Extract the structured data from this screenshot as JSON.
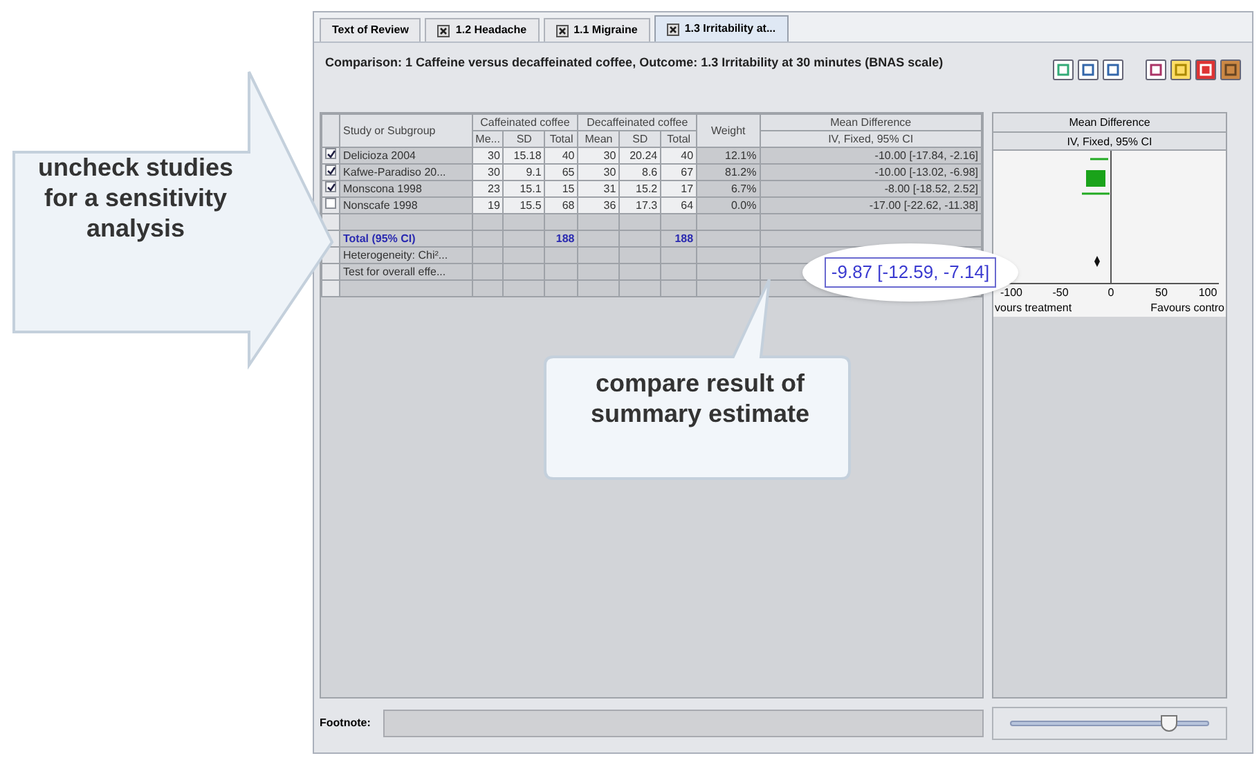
{
  "tabs": [
    {
      "label": "Text of Review",
      "kind": "plain",
      "selected": false
    },
    {
      "label": "1.2 Headache",
      "kind": "closable",
      "selected": false
    },
    {
      "label": "1.1 Migraine",
      "kind": "closable",
      "selected": false
    },
    {
      "label": "1.3 Irritability at...",
      "kind": "closable",
      "selected": true
    }
  ],
  "comparison_title": "Comparison: 1 Caffeine versus decaffeinated coffee, Outcome: 1.3 Irritability at 30 minutes (BNAS scale)",
  "table": {
    "study_header": "Study or Subgroup",
    "group_headers": [
      "Caffeinated coffee",
      "Decaffeinated coffee"
    ],
    "sub_headers": [
      "Me...",
      "SD",
      "Total",
      "Mean",
      "SD",
      "Total"
    ],
    "weight_header": "Weight",
    "effect_header": "Mean Difference",
    "effect_subheader": "IV, Fixed, 95% CI",
    "studies": [
      {
        "checked": true,
        "cells": [
          "Delicioza 2004",
          "30",
          "15.18",
          "40",
          "30",
          "20.24",
          "40",
          "12.1%",
          "-10.00 [-17.84, -2.16]"
        ]
      },
      {
        "checked": true,
        "cells": [
          "Kafwe-Paradiso 20...",
          "30",
          "9.1",
          "65",
          "30",
          "8.6",
          "67",
          "81.2%",
          "-10.00 [-13.02, -6.98]"
        ]
      },
      {
        "checked": true,
        "cells": [
          "Monscona 1998",
          "23",
          "15.1",
          "15",
          "31",
          "15.2",
          "17",
          "6.7%",
          "-8.00 [-18.52, 2.52]"
        ]
      },
      {
        "checked": false,
        "cells": [
          "Nonscafe 1998",
          "19",
          "15.5",
          "68",
          "36",
          "17.3",
          "64",
          "0.0%",
          "-17.00 [-22.62, -11.38]"
        ]
      }
    ],
    "total": {
      "label": "Total (95% CI)",
      "exp_total": "188",
      "ctrl_total": "188"
    },
    "summary_rows": [
      "Heterogeneity: Chi²...",
      "Test for overall effe..."
    ]
  },
  "forest_plot": {
    "title": "Mean Difference",
    "subtitle": "IV, Fixed, 95% CI",
    "ticks": [
      "-100",
      "-50",
      "0",
      "50",
      "100"
    ],
    "favours_left": "vours treatment",
    "favours_right": "Favours contro"
  },
  "footnote": {
    "label": "Footnote:"
  },
  "zoom_slider": {
    "level": 0.8
  },
  "callouts": {
    "arrow_text": "uncheck studies for a sensitivity analysis",
    "bubble_text": "compare result of summary estimate",
    "magnified_value": "-9.87 [-12.59, -7.14]"
  }
}
